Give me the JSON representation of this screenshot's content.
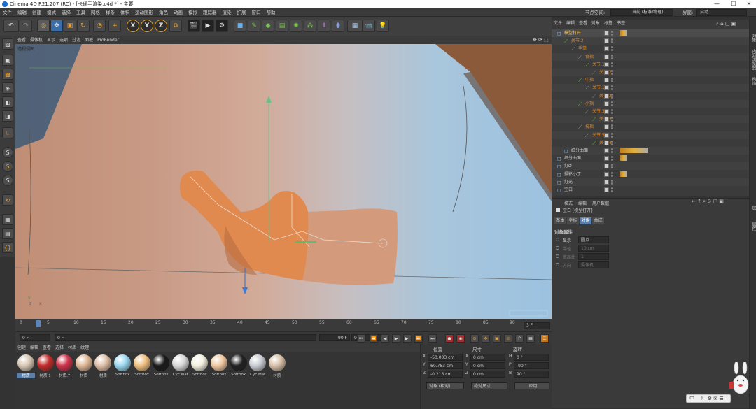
{
  "window": {
    "title": "Cinema 4D R21.207 (RC) - [卡通手渲染.c4d *] - 主要",
    "minimize": "—",
    "maximize": "☐",
    "close": "✕"
  },
  "menu": [
    "文件",
    "编辑",
    "创建",
    "模式",
    "选择",
    "工具",
    "网格",
    "样条",
    "体积",
    "运动图形",
    "角色",
    "动画",
    "模拟",
    "跟踪器",
    "渲染",
    "扩展",
    "窗口",
    "帮助"
  ],
  "layout": {
    "node_space_label": "节点空间:",
    "node_space_value": "当前 (标准/物理)",
    "interface_label": "界面:",
    "interface_value": "启动"
  },
  "toolbar_icons": [
    "undo-icon",
    "redo-icon",
    "live-select-icon",
    "move-icon",
    "scale-icon",
    "rotate-icon",
    "recent-icon",
    "axis-x-icon",
    "axis-y-icon",
    "axis-z-icon",
    "coord-system-icon",
    "render-view-icon",
    "render-picture-icon",
    "render-settings-icon",
    "cube-icon",
    "pen-icon",
    "subdivision-icon",
    "cloner-icon",
    "array-icon",
    "extrude-icon",
    "deformer-icon",
    "floor-icon",
    "camera-icon",
    "light-icon"
  ],
  "axis_labels": {
    "x": "X",
    "y": "Y",
    "z": "Z"
  },
  "viewport": {
    "menu": [
      "查看",
      "摄像机",
      "显示",
      "选项",
      "过滤",
      "面板",
      "ProRender"
    ],
    "label": "透视视图",
    "axis_y": "y",
    "axis_z": "z",
    "axis_x": "x"
  },
  "timeline": {
    "ticks": [
      "0",
      "5",
      "10",
      "15",
      "20",
      "25",
      "30",
      "35",
      "40",
      "45",
      "50",
      "55",
      "60",
      "65",
      "70",
      "75",
      "80",
      "85",
      "90"
    ],
    "current_frame": "3 F",
    "start_field": "0 F",
    "start_field2": "0 F",
    "end_field": "90 F",
    "end_field2": "90 F"
  },
  "materials": {
    "menu": [
      "创建",
      "编辑",
      "查看",
      "选择",
      "材质",
      "纹理"
    ],
    "items": [
      {
        "label": "材质",
        "color": "#d8c7b4"
      },
      {
        "label": "材质.1",
        "color": "#c42c2c"
      },
      {
        "label": "材质.7",
        "color": "#d0324a"
      },
      {
        "label": "材质",
        "color": "#e0b895"
      },
      {
        "label": "材质",
        "color": "#e0c0a8"
      },
      {
        "label": "Softbox",
        "color": "#9ad8f0"
      },
      {
        "label": "Softbox",
        "color": "#f0c080"
      },
      {
        "label": "Softbox",
        "color": "#1a1a1a"
      },
      {
        "label": "Cyc Mat",
        "color": "#d8d8d8"
      },
      {
        "label": "Softbox",
        "color": "#f4f0e0"
      },
      {
        "label": "Softbox",
        "color": "#f0c8a0"
      },
      {
        "label": "Softbox",
        "color": "#222222"
      },
      {
        "label": "Cyc Mat",
        "color": "#c8ccd4"
      },
      {
        "label": "材质",
        "color": "#d8c0a8"
      }
    ]
  },
  "coords": {
    "headers": [
      "位置",
      "尺寸",
      "旋转"
    ],
    "rows": [
      {
        "axis": "X",
        "pos": "-50.003 cm",
        "saxis": "X",
        "size": "0 cm",
        "raxis": "H",
        "rot": "0 °"
      },
      {
        "axis": "Y",
        "pos": "60.783 cm",
        "saxis": "Y",
        "size": "0 cm",
        "raxis": "P",
        "rot": "-90 °"
      },
      {
        "axis": "Z",
        "pos": "-0.213 cm",
        "saxis": "Z",
        "size": "0 cm",
        "raxis": "B",
        "rot": "90 °"
      }
    ],
    "mode": "对象 (相对)",
    "size_mode": "绝对尺寸",
    "apply": "应用"
  },
  "objects": {
    "menu": [
      "文件",
      "编辑",
      "查看",
      "对象",
      "标签",
      "书签"
    ],
    "rows": [
      {
        "name": "模型打开",
        "indent": 0,
        "orange": false
      },
      {
        "name": "关节.2",
        "indent": 1,
        "orange": true
      },
      {
        "name": "手掌",
        "indent": 2,
        "orange": true
      },
      {
        "name": "食指",
        "indent": 3,
        "orange": true
      },
      {
        "name": "关节.1",
        "indent": 4,
        "orange": true
      },
      {
        "name": "关节.2",
        "indent": 5,
        "orange": true
      },
      {
        "name": "中指",
        "indent": 3,
        "orange": true
      },
      {
        "name": "关节.1",
        "indent": 4,
        "orange": true
      },
      {
        "name": "关节.2",
        "indent": 5,
        "orange": true
      },
      {
        "name": "小指",
        "indent": 3,
        "orange": true
      },
      {
        "name": "关节.3",
        "indent": 4,
        "orange": true
      },
      {
        "name": "关节.3",
        "indent": 5,
        "orange": true
      },
      {
        "name": "拇指",
        "indent": 3,
        "orange": true
      },
      {
        "name": "关节.5",
        "indent": 4,
        "orange": true
      },
      {
        "name": "关节.4",
        "indent": 5,
        "orange": true
      },
      {
        "name": "细分曲面",
        "indent": 1,
        "orange": false
      },
      {
        "name": "细分曲面",
        "indent": 0,
        "orange": false
      },
      {
        "name": "灯Ø",
        "indent": 0,
        "orange": false
      },
      {
        "name": "摄影小丁",
        "indent": 0,
        "orange": false
      },
      {
        "name": "灯光",
        "indent": 0,
        "orange": false
      },
      {
        "name": "空白",
        "indent": 0,
        "orange": false
      }
    ]
  },
  "attributes": {
    "menu": [
      "模式",
      "编辑",
      "用户数据"
    ],
    "title": "空白 [模型打开]",
    "tabs": [
      "基本",
      "坐标",
      "对象",
      "合成"
    ],
    "active_tab": "对象",
    "section": "对象属性",
    "props": [
      {
        "label": "显示",
        "value": "圆点"
      },
      {
        "label": "半径",
        "value": "10 cm"
      },
      {
        "label": "宽高比",
        "value": "1"
      },
      {
        "label": "方向",
        "value": "摄像机"
      }
    ]
  },
  "sidebar_tabs": [
    "对象",
    "内容浏览器",
    "构造",
    "层",
    "属性"
  ],
  "tray": {
    "ime": "中",
    "moon": "☽"
  }
}
